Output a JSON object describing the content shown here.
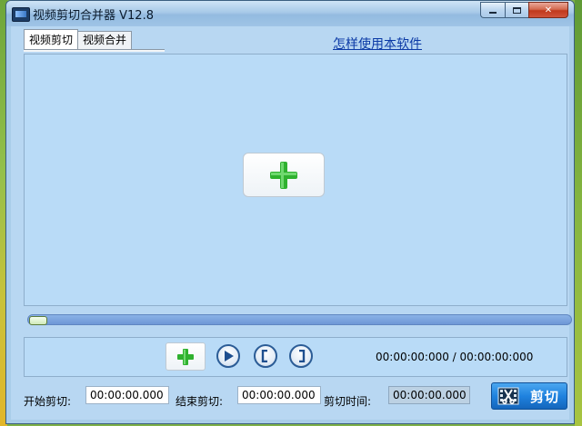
{
  "window": {
    "title": "视频剪切合并器 V12.8"
  },
  "tabs": [
    {
      "label": "视频剪切",
      "active": true
    },
    {
      "label": "视频合并",
      "active": false
    }
  ],
  "help_link": "怎样使用本软件",
  "progress": {
    "value": 0
  },
  "player": {
    "time_readout": "00:00:00:000 / 00:00:00:000"
  },
  "cut": {
    "start_label": "开始剪切:",
    "start_value": "00:00:00.000",
    "end_label": "结束剪切:",
    "end_value": "00:00:00.000",
    "duration_label": "剪切时间:",
    "duration_value": "00:00:00.000",
    "button_label": "剪切"
  },
  "colors": {
    "accent_green": "#2fb12f",
    "button_blue": "#1f82df",
    "panel_bg": "#b9dbf7"
  }
}
